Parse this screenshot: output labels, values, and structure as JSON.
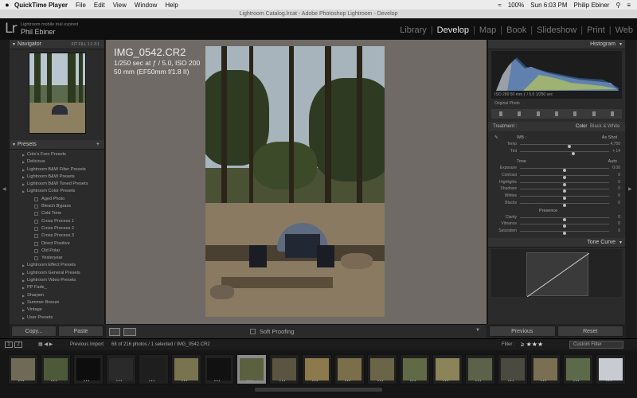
{
  "menubar": {
    "apple": "",
    "app": "QuickTime Player",
    "items": [
      "File",
      "Edit",
      "View",
      "Window",
      "Help"
    ],
    "clock": "Sun 6:03 PM",
    "user": "Philip Ebiner",
    "battery": "100%"
  },
  "window_title": "Lightroom Catalog.lrcat - Adobe Photoshop Lightroom - Develop",
  "identity": {
    "logo": "Lr",
    "notice": "Lightroom mobile trial expired",
    "name": "Phil Ebiner"
  },
  "modules": [
    "Library",
    "Develop",
    "Map",
    "Book",
    "Slideshow",
    "Print",
    "Web"
  ],
  "active_module": "Develop",
  "left": {
    "navigator_title": "Navigator",
    "navigator_zoom": "FIT  FILL  1:1  3:1",
    "presets_title": "Presets",
    "presets": [
      {
        "label": "Cole's Free Presets",
        "sub": false
      },
      {
        "label": "Delicious",
        "sub": false
      },
      {
        "label": "Lightroom B&W Filter Presets",
        "sub": false
      },
      {
        "label": "Lightroom B&W Presets",
        "sub": false
      },
      {
        "label": "Lightroom B&W Toned Presets",
        "sub": false
      },
      {
        "label": "Lightroom Color Presets",
        "sub": false
      },
      {
        "label": "Aged Photo",
        "sub": true
      },
      {
        "label": "Bleach Bypass",
        "sub": true
      },
      {
        "label": "Cold Tone",
        "sub": true
      },
      {
        "label": "Cross Process 1",
        "sub": true
      },
      {
        "label": "Cross Process 2",
        "sub": true
      },
      {
        "label": "Cross Process 3",
        "sub": true
      },
      {
        "label": "Direct Positive",
        "sub": true
      },
      {
        "label": "Old Polar",
        "sub": true
      },
      {
        "label": "Yesteryear",
        "sub": true
      },
      {
        "label": "Lightroom Effect Presets",
        "sub": false
      },
      {
        "label": "Lightroom General Presets",
        "sub": false
      },
      {
        "label": "Lightroom Video Presets",
        "sub": false
      },
      {
        "label": "PP Fade_",
        "sub": false
      },
      {
        "label": "Sharpen",
        "sub": false
      },
      {
        "label": "Summer Breeze",
        "sub": false
      },
      {
        "label": "Vintage",
        "sub": false
      },
      {
        "label": "User Presets",
        "sub": false
      }
    ],
    "copy_label": "Copy...",
    "paste_label": "Paste"
  },
  "center": {
    "filename": "IMG_0542.CR2",
    "exposure": "1/250 sec at ƒ / 5.0, ISO 200",
    "lens": "50 mm (EF50mm f/1.8 II)",
    "soft_proofing": "Soft Proofing"
  },
  "right": {
    "histogram_title": "Histogram",
    "histo_info": "ISO 200     50 mm     ƒ / 5.0     1/250 sec",
    "original_photo": "Original Photo",
    "treatment_label": "Treatment :",
    "color_label": "Color",
    "bw_label": "Black & White",
    "wb_label": "WB :",
    "wb_value": "As Shot",
    "tone_label": "Tone",
    "auto_label": "Auto",
    "presence_label": "Presence",
    "sliders_top": [
      {
        "label": "Temp",
        "value": "4,750",
        "pos": 0.55
      },
      {
        "label": "Tint",
        "value": "+ 14",
        "pos": 0.6
      }
    ],
    "sliders_tone": [
      {
        "label": "Exposure",
        "value": "0.00",
        "pos": 0.5
      },
      {
        "label": "Contrast",
        "value": "0",
        "pos": 0.5
      },
      {
        "label": "Highlights",
        "value": "0",
        "pos": 0.5
      },
      {
        "label": "Shadows",
        "value": "0",
        "pos": 0.5
      },
      {
        "label": "Whites",
        "value": "0",
        "pos": 0.5
      },
      {
        "label": "Blacks",
        "value": "0",
        "pos": 0.5
      }
    ],
    "sliders_presence": [
      {
        "label": "Clarity",
        "value": "0",
        "pos": 0.5
      },
      {
        "label": "Vibrance",
        "value": "0",
        "pos": 0.5
      },
      {
        "label": "Saturation",
        "value": "0",
        "pos": 0.5
      }
    ],
    "tone_curve_title": "Tone Curve",
    "previous_label": "Previous",
    "reset_label": "Reset"
  },
  "filmstrip_header": {
    "page1": "1",
    "page2": "2",
    "previous_import": "Previous Import",
    "path": "68 of 216 photos / 1 selected / IMG_0542.CR2",
    "filter_label": "Filter :",
    "stars": "≥ ★★★",
    "custom_filter": "Custom Filter"
  },
  "filmstrip": [
    {
      "color": "#6e6a55"
    },
    {
      "color": "#4d5a3a"
    },
    {
      "color": "#0d0d0d"
    },
    {
      "color": "#2a2a2a"
    },
    {
      "color": "#1e1e1e"
    },
    {
      "color": "#7a7350"
    },
    {
      "color": "#111111"
    },
    {
      "color": "#5b6140",
      "selected": true
    },
    {
      "color": "#5a5440"
    },
    {
      "color": "#8c7a4c"
    },
    {
      "color": "#7b6e4a"
    },
    {
      "color": "#6b6548"
    },
    {
      "color": "#606a45"
    },
    {
      "color": "#8a8458"
    },
    {
      "color": "#5c6248"
    },
    {
      "color": "#4b4a40"
    },
    {
      "color": "#7a6f52"
    },
    {
      "color": "#5d6a4a"
    },
    {
      "color": "#c8ccd2"
    }
  ]
}
